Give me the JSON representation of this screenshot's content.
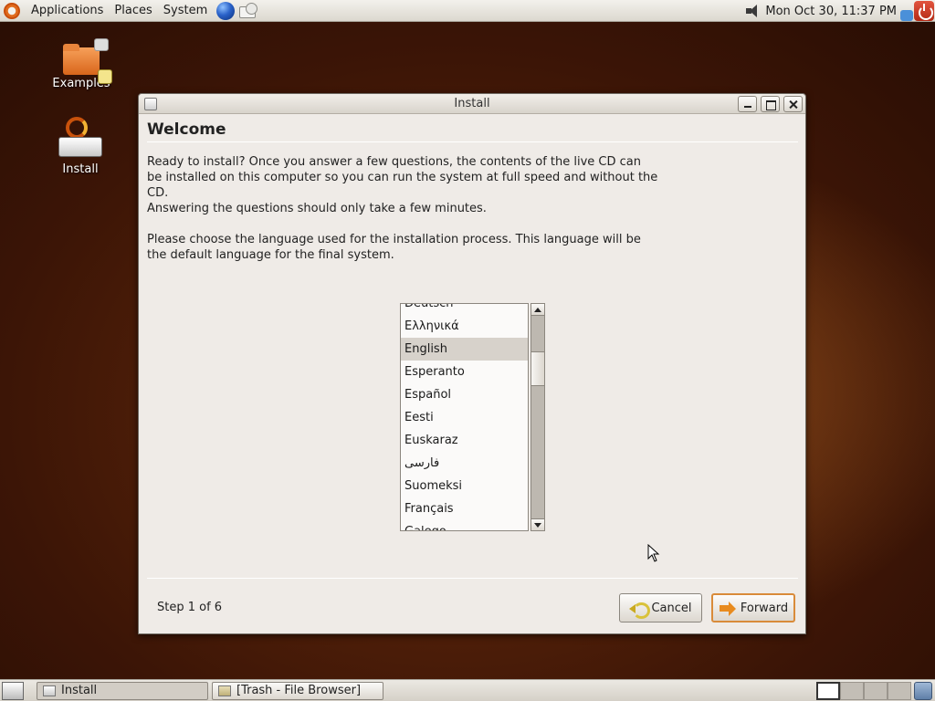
{
  "top_panel": {
    "menus": [
      "Applications",
      "Places",
      "System"
    ],
    "clock": "Mon Oct 30, 11:37 PM"
  },
  "desktop": {
    "icons": [
      {
        "label": "Examples"
      },
      {
        "label": "Install"
      }
    ]
  },
  "window": {
    "title": "Install",
    "heading": "Welcome",
    "paragraphs": [
      "Ready to install? Once you answer a few questions, the contents of the live CD can be installed on this computer so you can run the system at full speed and without the CD.",
      "Answering the questions should only take a few minutes.",
      "Please choose the language used for the installation process. This language will be the default language for the final system."
    ],
    "languages": [
      "Deutsch",
      "Ελληνικά",
      "English",
      "Esperanto",
      "Español",
      "Eesti",
      "Euskaraz",
      "فارسی",
      "Suomeksi",
      "Français",
      "Galego"
    ],
    "selected_language": "English",
    "step": "Step 1 of 6",
    "cancel_label": "Cancel",
    "forward_label": "Forward"
  },
  "taskbar": {
    "tasks": [
      "Install",
      "[Trash - File Browser]"
    ]
  }
}
